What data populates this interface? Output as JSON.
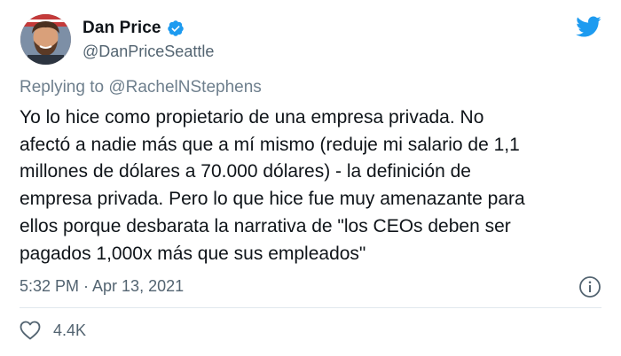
{
  "author": {
    "display_name": "Dan Price",
    "handle": "@DanPriceSeattle"
  },
  "reply": {
    "prefix": "Replying to ",
    "mention": "@RachelNStephens"
  },
  "tweet": {
    "text": "Yo lo hice como propietario de una empresa privada. No\nafectó a nadie más que a mí mismo (reduje mi salario de 1,1\nmillones de dólares a 70.000 dólares) - la definición de\nempresa privada. Pero lo que hice fue muy amenazante para\nellos porque desbarata la narrativa de \"los CEOs deben ser\npagados 1,000x más que sus empleados\"",
    "timestamp": "5:32 PM · Apr 13, 2021"
  },
  "stats": {
    "likes": "4.4K"
  },
  "icons": {
    "verified": "verified-badge-icon",
    "logo": "twitter-bird-icon",
    "info": "info-icon",
    "like": "heart-icon"
  },
  "colors": {
    "brand_blue": "#1d9bf0",
    "text_primary": "#0f1419",
    "text_secondary": "#536471"
  }
}
